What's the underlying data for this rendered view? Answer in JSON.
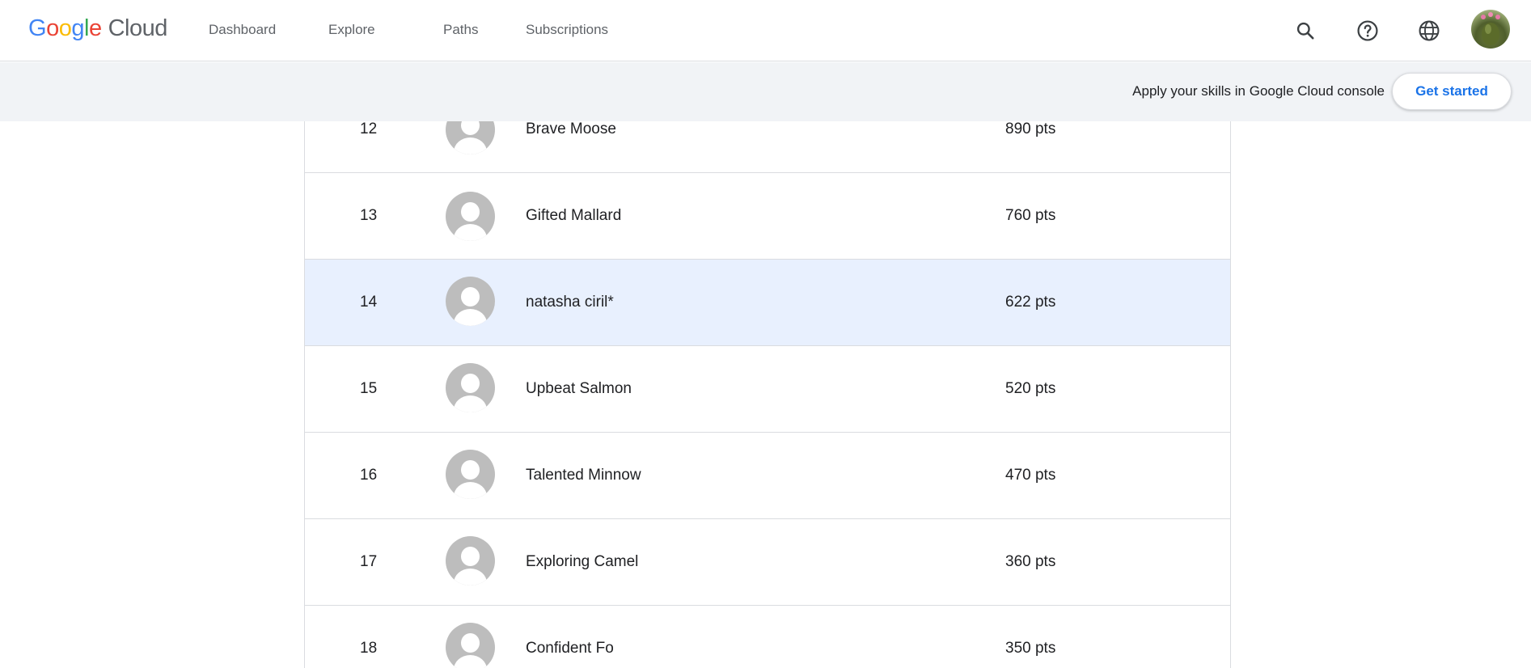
{
  "header": {
    "logo": {
      "google": [
        "G",
        "o",
        "o",
        "g",
        "l",
        "e"
      ],
      "product": "Cloud"
    },
    "nav": [
      {
        "label": "Dashboard"
      },
      {
        "label": "Explore"
      },
      {
        "label": "Paths"
      },
      {
        "label": "Subscriptions"
      }
    ],
    "icons": [
      "search-icon",
      "help-icon",
      "globe-icon"
    ]
  },
  "banner": {
    "text": "Apply your skills in Google Cloud console",
    "button_label": "Get started"
  },
  "leaderboard": {
    "rows": [
      {
        "rank": "12",
        "name": "Brave Moose",
        "points": "890 pts",
        "highlighted": false
      },
      {
        "rank": "13",
        "name": "Gifted Mallard",
        "points": "760 pts",
        "highlighted": false
      },
      {
        "rank": "14",
        "name": "natasha ciril*",
        "points": "622 pts",
        "highlighted": true
      },
      {
        "rank": "15",
        "name": "Upbeat Salmon",
        "points": "520 pts",
        "highlighted": false
      },
      {
        "rank": "16",
        "name": "Talented Minnow",
        "points": "470 pts",
        "highlighted": false
      },
      {
        "rank": "17",
        "name": "Exploring Camel",
        "points": "360 pts",
        "highlighted": false
      },
      {
        "rank": "18",
        "name": "Confident Fo",
        "points": "350 pts",
        "highlighted": false
      }
    ]
  },
  "colors": {
    "accent": "#1a73e8",
    "highlight_row": "#e8f0fe",
    "banner_bg": "#f1f3f6",
    "divider": "#dadce0"
  }
}
